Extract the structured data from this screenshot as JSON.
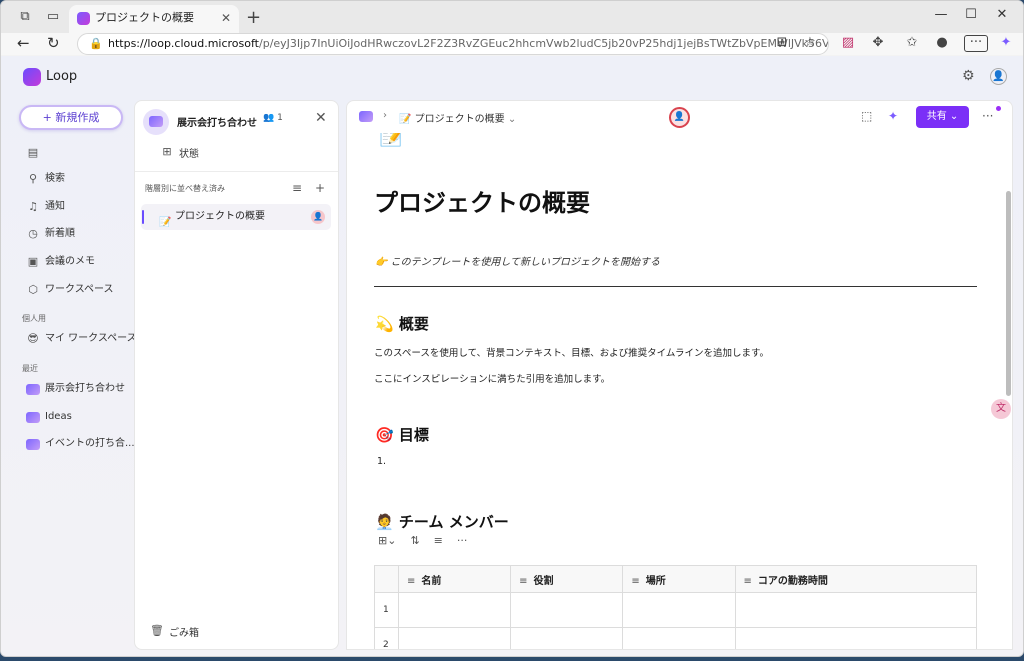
{
  "browser": {
    "tab_title": "プロジェクトの概要",
    "tab_close": "✕",
    "new_tab": "+",
    "url_host": "https://loop.cloud.microsoft",
    "url_path": "/p/eyJ3Ijp7InUiOiJodHRwczovL2F2Z3RvZGEuc2hhcmVwb2ludC5jb20vP25hdj1jejBsTWtZbVpEMWlJVk56VUV4Qk1WaEVVa1Z..."
  },
  "app": {
    "name": "Loop"
  },
  "sidebar": {
    "new_button": "新規作成",
    "items": [
      {
        "icon": "▤",
        "label": ""
      },
      {
        "icon": "⚲",
        "label": "検索"
      },
      {
        "icon": "♫",
        "label": "通知"
      },
      {
        "icon": "◷",
        "label": "新着順"
      },
      {
        "icon": "▣",
        "label": "会議のメモ"
      },
      {
        "icon": "⬡",
        "label": "ワークスペース"
      }
    ],
    "section_personal": "個人用",
    "personal_items": [
      {
        "icon": "😎",
        "label": "マイ ワークスペース"
      }
    ],
    "section_recent": "最近",
    "recent_items": [
      {
        "label": "展示会打ち合わせ"
      },
      {
        "label": "Ideas"
      },
      {
        "label": "イベントの打ち合..."
      }
    ]
  },
  "workspace_panel": {
    "title": "展示会打ち合わせ",
    "member_count": "1",
    "status_label": "状態",
    "sort_label": "階層別に並べ替え済み",
    "pages": [
      {
        "icon": "📝",
        "label": "プロジェクトの概要"
      }
    ],
    "trash_label": "ごみ箱"
  },
  "document": {
    "breadcrumb_page": "プロジェクトの概要",
    "share_label": "共有",
    "title": "プロジェクトの概要",
    "hint_emoji": "👉",
    "hint": "このテンプレートを使用して新しいプロジェクトを開始する",
    "sections": [
      {
        "emoji": "💫",
        "heading": "概要"
      },
      {
        "emoji": "🎯",
        "heading": "目標"
      },
      {
        "emoji": "🧑‍💼",
        "heading": "チーム メンバー"
      }
    ],
    "overview_p1": "このスペースを使用して、背景コンテキスト、目標、および推奨タイムラインを追加します。",
    "overview_p2": "ここにインスピレーションに満ちた引用を追加します。",
    "goals_list_item": "1.",
    "table": {
      "columns": [
        "名前",
        "役割",
        "場所",
        "コアの勤務時間"
      ],
      "row_numbers": [
        "1",
        "2"
      ]
    }
  }
}
